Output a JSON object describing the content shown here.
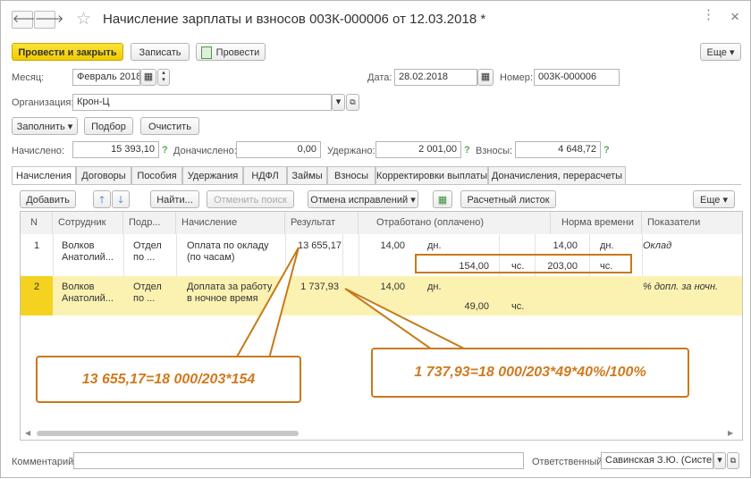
{
  "window": {
    "title": "Начисление зарплаты и взносов 003К-000006 от 12.03.2018 *",
    "more_dots": "⋮",
    "close": "×"
  },
  "toolbar": {
    "post_close": "Провести и закрыть",
    "save": "Записать",
    "post": "Провести",
    "more": "Еще"
  },
  "form": {
    "month_label": "Месяц:",
    "month_value": "Февраль 2018",
    "date_label": "Дата:",
    "date_value": "28.02.2018",
    "number_label": "Номер:",
    "number_value": "003К-000006",
    "org_label": "Организация:",
    "org_value": "Крон-Ц",
    "fill_btn": "Заполнить",
    "select_btn": "Подбор",
    "clear_btn": "Очистить",
    "accrued_label": "Начислено:",
    "accrued_value": "15 393,10",
    "extra_label": "Доначислено:",
    "extra_value": "0,00",
    "withheld_label": "Удержано:",
    "withheld_value": "2 001,00",
    "contrib_label": "Взносы:",
    "contrib_value": "4 648,72"
  },
  "tabs": [
    "Начисления",
    "Договоры",
    "Пособия",
    "Удержания",
    "НДФЛ",
    "Займы",
    "Взносы",
    "Корректировки выплаты",
    "Доначисления, перерасчеты"
  ],
  "subtoolbar": {
    "add": "Добавить",
    "find": "Найти...",
    "cancel_search": "Отменить поиск",
    "cancel_fix": "Отмена исправлений",
    "payslip": "Расчетный листок",
    "more": "Еще"
  },
  "table": {
    "headers": [
      "N",
      "Сотрудник",
      "Подр...",
      "Начисление",
      "Результат",
      "Отработано (оплачено)",
      "Норма времени",
      "Показатели"
    ],
    "rows": [
      {
        "n": "1",
        "emp1": "Волков",
        "emp2": "Анатолий...",
        "dep1": "Отдел",
        "dep2": "по ...",
        "acc1": "Оплата по окладу",
        "acc2": "(по часам)",
        "result": "13 655,17",
        "days": "14,00",
        "days_unit": "дн.",
        "hours": "154,00",
        "hours_unit": "чс.",
        "norm_days": "14,00",
        "norm_days_unit": "дн.",
        "norm_hours": "203,00",
        "norm_hours_unit": "чс.",
        "indicator": "Оклад"
      },
      {
        "n": "2",
        "emp1": "Волков",
        "emp2": "Анатолий...",
        "dep1": "Отдел",
        "dep2": "по ...",
        "acc1": "Доплата за работу",
        "acc2": "в ночное время",
        "result": "1 737,93",
        "days": "14,00",
        "days_unit": "дн.",
        "hours": "49,00",
        "hours_unit": "чс.",
        "indicator": "% допл. за ночн."
      }
    ]
  },
  "callouts": {
    "left": "13 655,17=18 000/203*154",
    "right": "1 737,93=18 000/203*49*40%/100%"
  },
  "footer": {
    "comment_label": "Комментарий:",
    "comment_value": "",
    "resp_label": "Ответственный:",
    "resp_value": "Савинская З.Ю. (Систем"
  },
  "colors": {
    "primary": "#f4d21f",
    "selected_row": "#fbf2b2",
    "callout": "#c77a1a"
  }
}
